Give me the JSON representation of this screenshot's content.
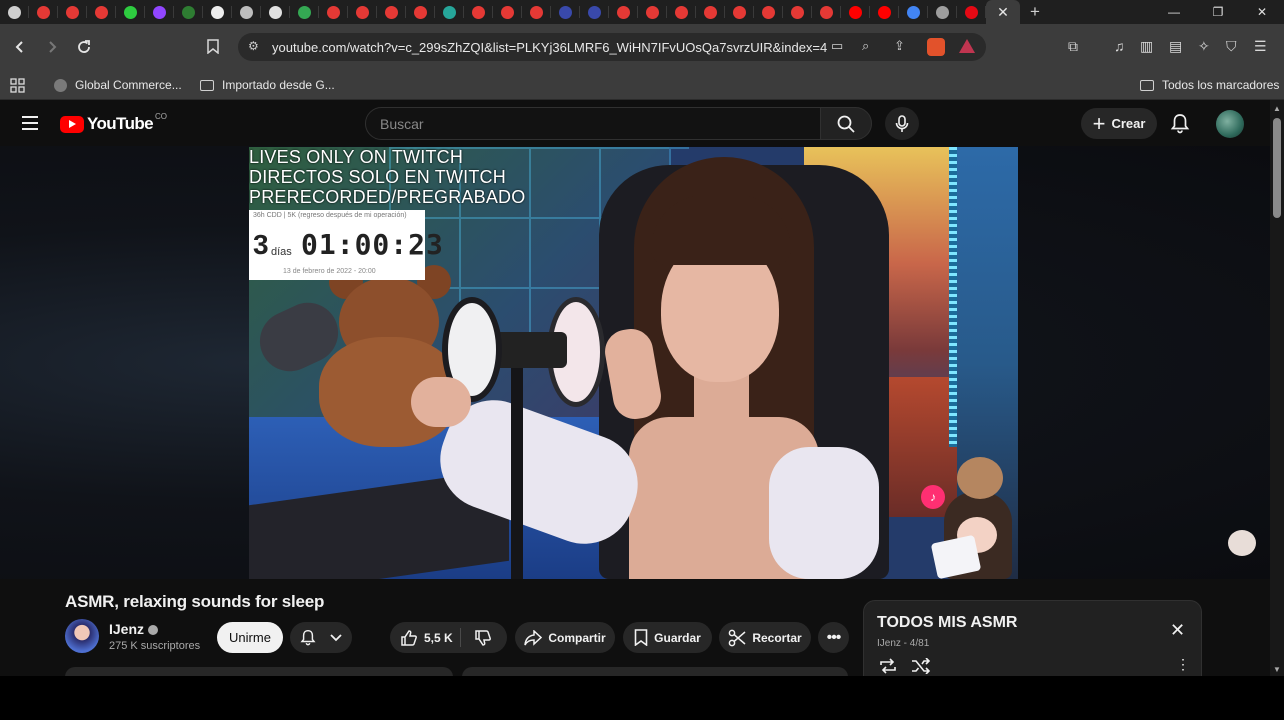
{
  "browser": {
    "tab_favicons": [
      "#cfcfcf",
      "#e53935",
      "#e53935",
      "#e53935",
      "#2ecc40",
      "#9146ff",
      "#2e7d32",
      "#eeeeee",
      "#bdbdbd",
      "#e0e0e0",
      "#34a853",
      "#e53935",
      "#e53935",
      "#e53935",
      "#e53935",
      "#26a69a",
      "#e53935",
      "#e53935",
      "#e53935",
      "#3949ab",
      "#3949ab",
      "#e53935",
      "#e53935",
      "#e53935",
      "#e53935",
      "#e53935",
      "#e53935",
      "#e53935",
      "#e53935",
      "#ff0000",
      "#ff0000",
      "#4285f4",
      "#9e9e9e",
      "#e50914"
    ],
    "active_tab_close": "✕",
    "new_tab": "+",
    "window_controls": {
      "minimize": "—",
      "restore": "❐",
      "close": "✕"
    },
    "url": "youtube.com/watch?v=c_299sZhZQI&list=PLKYj36LMRF6_WiHN7IFvUOsQa7svrzUIR&index=4",
    "bookmarks": [
      {
        "label": "Global Commerce...",
        "icon": "globe-icon"
      },
      {
        "label": "Importado desde G...",
        "icon": "folder-icon"
      }
    ],
    "all_bookmarks": "Todos los marcadores"
  },
  "youtube": {
    "logo_text": "YouTube",
    "country": "CO",
    "search_placeholder": "Buscar",
    "create_label": "Crear",
    "video": {
      "overlay_lines": [
        "LIVES ONLY ON TWITCH",
        "DIRECTOS SOLO EN TWITCH",
        "PRERECORDED/PREGRABADO"
      ],
      "countdown": {
        "header": "36h CDD | 5K (regreso después de mi operación)",
        "days": "3",
        "days_label": "días",
        "time": "01:00:23",
        "date": "13 de febrero de 2022 - 20:00"
      }
    },
    "title": "ASMR, relaxing sounds for sleep",
    "channel": {
      "name": "IJenz",
      "subscribers": "275 K suscriptores"
    },
    "join_label": "Unirme",
    "actions": {
      "likes": "5,5 K",
      "share": "Compartir",
      "save": "Guardar",
      "clip": "Recortar",
      "more": "•••"
    },
    "playlist": {
      "title": "TODOS MIS ASMR",
      "owner": "IJenz",
      "position": "4/81",
      "close": "✕",
      "more": "⋮"
    }
  }
}
